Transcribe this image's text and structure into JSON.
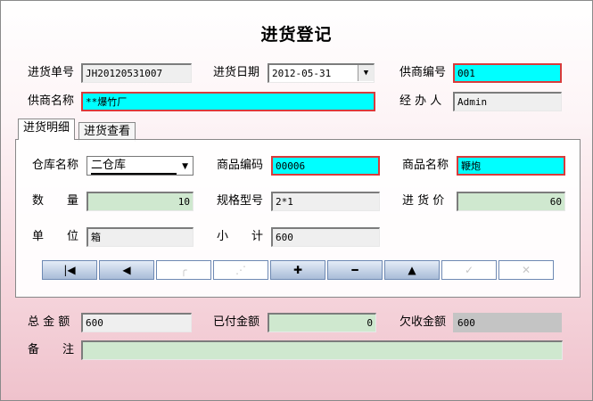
{
  "title": "进货登记",
  "header": {
    "order_no_label": "进货单号",
    "order_no": "JH20120531007",
    "date_label": "进货日期",
    "date": "2012-05-31",
    "supplier_code_label": "供商编号",
    "supplier_code": "001",
    "supplier_name_label": "供商名称",
    "supplier_name": "**爆竹厂",
    "handler_label": "经 办 人",
    "handler": "Admin"
  },
  "tabs": [
    {
      "label": "进货明细"
    },
    {
      "label": "进货查看"
    }
  ],
  "detail": {
    "warehouse_label": "仓库名称",
    "warehouse": "二仓库",
    "product_code_label": "商品编码",
    "product_code": "00006",
    "product_name_label": "商品名称",
    "product_name": "鞭炮",
    "qty_label": "数　　量",
    "qty": "10",
    "spec_label": "规格型号",
    "spec": "2*1",
    "price_label": "进 货 价",
    "price": "60",
    "unit_label": "单　　位",
    "unit": "箱",
    "subtotal_label": "小　　计",
    "subtotal": "600"
  },
  "nav": {
    "first": "|◀",
    "prev": "◀",
    "b3": "╭",
    "b4": "⋰",
    "add": "✚",
    "minus": "━",
    "up": "▲",
    "b8": "✓",
    "b9": "✕"
  },
  "footer": {
    "total_label": "总 金 额",
    "total": "600",
    "paid_label": "已付金额",
    "paid": "0",
    "owed_label": "欠收金额",
    "owed": "600",
    "remark_label": "备　　注",
    "remark": ""
  },
  "colors": {
    "highlight": "#00ffff",
    "editable": "#cfe8cf",
    "readonly": "#efefef",
    "border_red": "#d93b3b"
  }
}
